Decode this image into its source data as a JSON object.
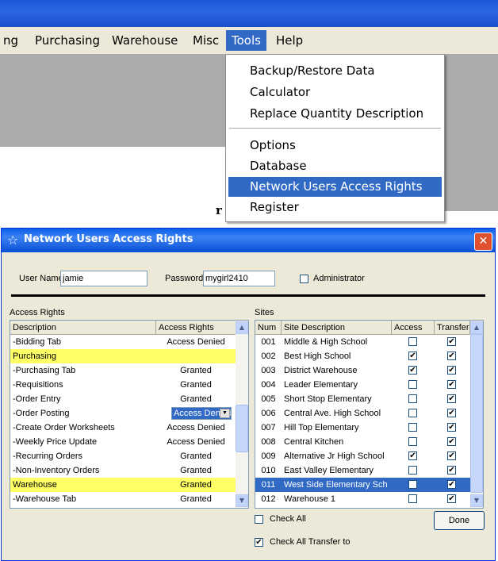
{
  "menubar": {
    "items": [
      "ng",
      "Purchasing",
      "Warehouse",
      "Misc",
      "Tools",
      "Help"
    ]
  },
  "tools_menu": {
    "items": [
      {
        "label": "Backup/Restore Data"
      },
      {
        "label": "Calculator"
      },
      {
        "label": "Replace Quantity Description"
      },
      {
        "label": "Options"
      },
      {
        "label": "Database"
      },
      {
        "label": "Network Users Access Rights"
      },
      {
        "label": "Register"
      }
    ]
  },
  "stray_text": "r",
  "dialog": {
    "title": "Network Users Access Rights",
    "close_glyph": "✕",
    "user_name_label": "User Name",
    "user_name_value": "jamie",
    "password_label": "Password",
    "password_value": "mygirl2410",
    "administrator_label": "Administrator",
    "access_rights_label": "Access Rights",
    "sites_label": "Sites",
    "access_grid": {
      "headers": [
        "Description",
        "Access Rights"
      ],
      "rows": [
        {
          "desc": "-Bidding Tab",
          "right": "Access Denied",
          "style": ""
        },
        {
          "desc": "Purchasing",
          "right": "",
          "style": "yellow"
        },
        {
          "desc": "-Purchasing Tab",
          "right": "Granted",
          "style": ""
        },
        {
          "desc": "-Requisitions",
          "right": "Granted",
          "style": ""
        },
        {
          "desc": "-Order Entry",
          "right": "Granted",
          "style": ""
        },
        {
          "desc": "-Order Posting",
          "right": "Access Denied",
          "style": "combo"
        },
        {
          "desc": "-Create Order Worksheets",
          "right": "Access Denied",
          "style": ""
        },
        {
          "desc": "-Weekly Price Update",
          "right": "Access Denied",
          "style": ""
        },
        {
          "desc": "-Recurring Orders",
          "right": "Granted",
          "style": ""
        },
        {
          "desc": "-Non-Inventory Orders",
          "right": "Granted",
          "style": ""
        },
        {
          "desc": "Warehouse",
          "right": "Granted",
          "style": "yellow"
        },
        {
          "desc": "-Warehouse Tab",
          "right": "Granted",
          "style": ""
        }
      ]
    },
    "sites_grid": {
      "headers": [
        "Num",
        "Site Description",
        "Access",
        "Transfer"
      ],
      "rows": [
        {
          "num": "001",
          "desc": "Middle & High School",
          "access": false,
          "transfer": true
        },
        {
          "num": "002",
          "desc": "Best High School",
          "access": true,
          "transfer": true
        },
        {
          "num": "003",
          "desc": "District Warehouse",
          "access": true,
          "transfer": true
        },
        {
          "num": "004",
          "desc": "Leader Elementary",
          "access": false,
          "transfer": true
        },
        {
          "num": "005",
          "desc": "Short Stop Elementary",
          "access": false,
          "transfer": true
        },
        {
          "num": "006",
          "desc": "Central Ave. High School",
          "access": false,
          "transfer": true
        },
        {
          "num": "007",
          "desc": "Hill Top Elementary",
          "access": false,
          "transfer": true
        },
        {
          "num": "008",
          "desc": "Central Kitchen",
          "access": false,
          "transfer": true
        },
        {
          "num": "009",
          "desc": "Alternative Jr High School",
          "access": true,
          "transfer": true
        },
        {
          "num": "010",
          "desc": "East Valley Elementary",
          "access": false,
          "transfer": true
        },
        {
          "num": "011",
          "desc": "West Side Elementary Sch",
          "access": false,
          "transfer": true,
          "selected": true
        },
        {
          "num": "012",
          "desc": "Warehouse 1",
          "access": false,
          "transfer": true
        }
      ]
    },
    "check_all_label": "Check All",
    "check_all_transfer_label": "Check All Transfer to",
    "done_label": "Done"
  },
  "colors": {
    "highlight": "#316ac5",
    "group_row": "#ffff66",
    "titlebar": "#0a5fe8"
  }
}
